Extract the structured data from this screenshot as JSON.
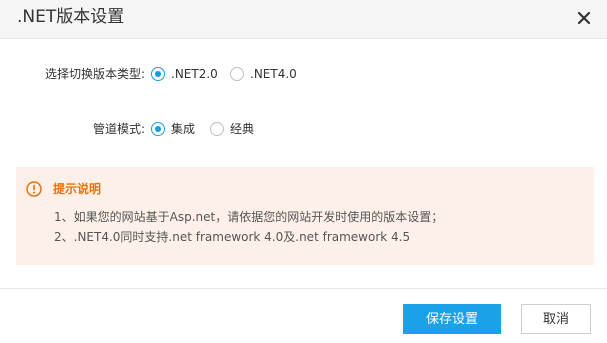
{
  "dialog": {
    "title": ".NET版本设置"
  },
  "icons": {
    "close": "close-icon",
    "notice": "exclamation-circle-icon"
  },
  "colors": {
    "accent": "#1a9ae0",
    "primary_button": "#1aa1e8",
    "notice_background": "#fdf0e8",
    "notice_title": "#e8720c"
  },
  "form": {
    "version": {
      "label": "选择切换版本类型:",
      "options": [
        {
          "label": ".NET2.0",
          "checked": true
        },
        {
          "label": ".NET4.0",
          "checked": false
        }
      ]
    },
    "pipeline": {
      "label": "管道模式:",
      "options": [
        {
          "label": "集成",
          "checked": true
        },
        {
          "label": "经典",
          "checked": false
        }
      ]
    }
  },
  "notice": {
    "title": "提示说明",
    "lines": [
      "1、如果您的网站基于Asp.net，请依据您的网站开发时使用的版本设置；",
      "2、.NET4.0同时支持.net framework 4.0及.net framework 4.5"
    ]
  },
  "footer": {
    "save_label": "保存设置",
    "cancel_label": "取消"
  }
}
